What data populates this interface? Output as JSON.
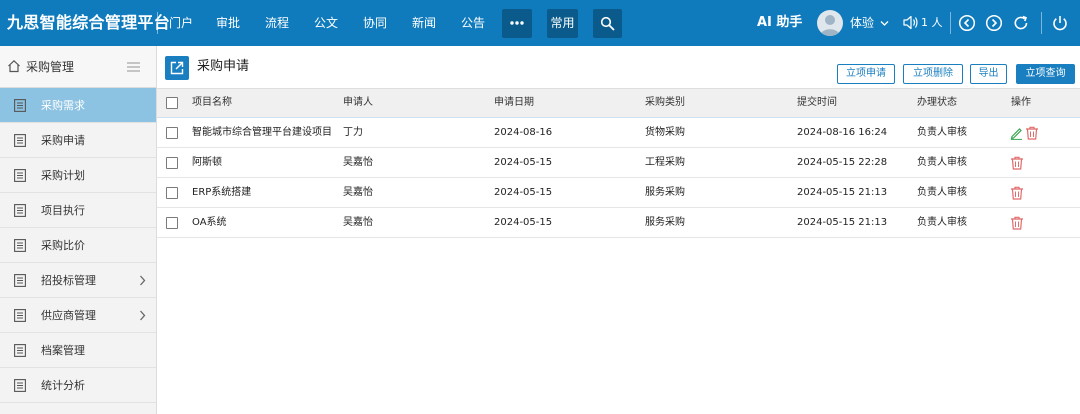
{
  "app": {
    "title": "九思智能综合管理平台"
  },
  "nav": {
    "items": [
      "门户",
      "审批",
      "流程",
      "公文",
      "协同",
      "新闻",
      "公告"
    ],
    "common_label": "常用",
    "more_icon": "more-dots-icon",
    "search_icon": "search-icon"
  },
  "header": {
    "ai_label": "AI 助手",
    "user_name": "体验",
    "online_count": "1 人"
  },
  "sidebar": {
    "title": "采购管理",
    "items": [
      {
        "label": "采购需求",
        "active": true,
        "has_children": false
      },
      {
        "label": "采购申请",
        "active": false,
        "has_children": false
      },
      {
        "label": "采购计划",
        "active": false,
        "has_children": false
      },
      {
        "label": "项目执行",
        "active": false,
        "has_children": false
      },
      {
        "label": "采购比价",
        "active": false,
        "has_children": false
      },
      {
        "label": "招投标管理",
        "active": false,
        "has_children": true
      },
      {
        "label": "供应商管理",
        "active": false,
        "has_children": true
      },
      {
        "label": "档案管理",
        "active": false,
        "has_children": false
      },
      {
        "label": "统计分析",
        "active": false,
        "has_children": false
      }
    ]
  },
  "page": {
    "title": "采购申请"
  },
  "toolbar": {
    "apply_label": "立项申请",
    "delete_label": "立项删除",
    "export_label": "导出",
    "query_label": "立项查询"
  },
  "table": {
    "headers": [
      "项目名称",
      "申请人",
      "申请日期",
      "采购类别",
      "提交时间",
      "办理状态",
      "操作"
    ],
    "rows": [
      {
        "name": "智能城市综合管理平台建设项目",
        "applicant": "丁力",
        "date": "2024-08-16",
        "category": "货物采购",
        "submitted": "2024-08-16 16:24",
        "status": "负责人审核",
        "editable": true
      },
      {
        "name": "阿斯顿",
        "applicant": "吴嘉怡",
        "date": "2024-05-15",
        "category": "工程采购",
        "submitted": "2024-05-15 22:28",
        "status": "负责人审核",
        "editable": false
      },
      {
        "name": "ERP系统搭建",
        "applicant": "吴嘉怡",
        "date": "2024-05-15",
        "category": "服务采购",
        "submitted": "2024-05-15 21:13",
        "status": "负责人审核",
        "editable": false
      },
      {
        "name": "OA系统",
        "applicant": "吴嘉怡",
        "date": "2024-05-15",
        "category": "服务采购",
        "submitted": "2024-05-15 21:13",
        "status": "负责人审核",
        "editable": false
      }
    ]
  },
  "colors": {
    "topbar": "#0f7bbd",
    "topbar_dark": "#0a5b8c",
    "accent": "#1a7fc1",
    "sidebar_active": "#8cc2e2",
    "edit_icon": "#3aa655",
    "delete_icon": "#e06b6b"
  }
}
